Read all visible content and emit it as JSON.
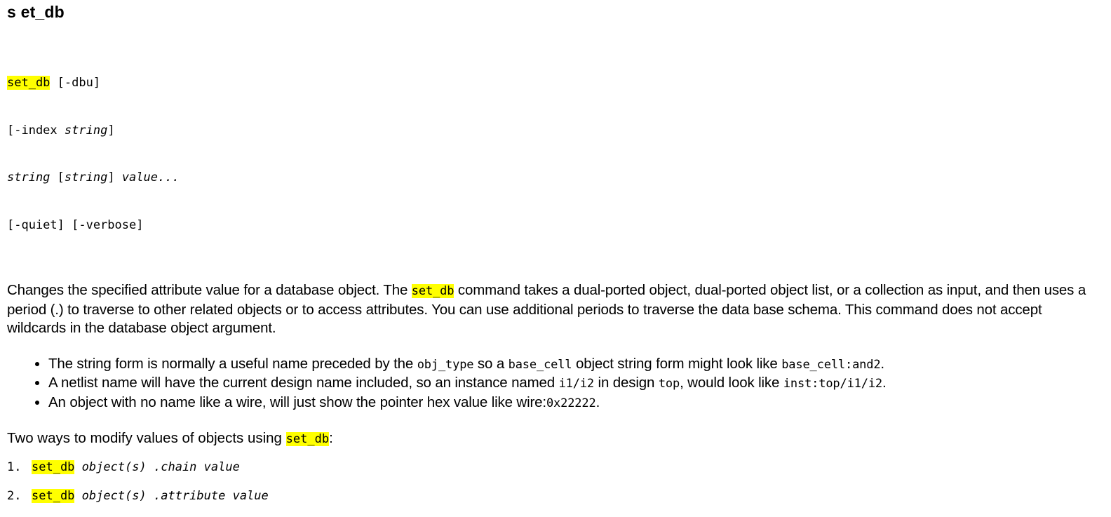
{
  "page": {
    "title": "s et_db"
  },
  "synopsis": {
    "cmd": "set_db",
    "line1_rest": " [-dbu]",
    "line2_open": "[-index ",
    "line2_arg": "string",
    "line2_close": "]",
    "line3_arg1": "string",
    "line3_mid": " [",
    "line3_arg2": "string",
    "line3_close": "] ",
    "line3_arg3": "value...",
    "line4": "[-quiet] [-verbose]"
  },
  "description": {
    "before": "Changes the specified attribute value for a database object. The ",
    "cmd": "set_db",
    "after": " command takes a dual-ported object, dual-ported object list, or a collection as input, and then uses a period (.) to traverse to other related objects or to access attributes. You can use additional periods to traverse the data base schema. This command does not accept wildcards in the database object argument."
  },
  "bullets": [
    {
      "t1": "The string form is normally a useful name preceded by the ",
      "c1": "obj_type",
      "t2": " so a ",
      "c2": "base_cell",
      "t3": " object string form might look like ",
      "c3": "base_cell:and2",
      "t4": "."
    },
    {
      "t1": "A netlist name will have the current design name included, so an instance named ",
      "c1": "i1/i2",
      "t2": " in design ",
      "c2": "top",
      "t3": ", would look like ",
      "c3": "inst:top/i1/i2",
      "t4": "."
    },
    {
      "t1": "An object with no name like a wire, will just show the pointer hex value like wire:",
      "c1": "0x22222",
      "t2": "."
    }
  ],
  "two_ways": {
    "text": "Two ways to modify values of objects using ",
    "cmd": "set_db",
    "suffix": ":"
  },
  "commands": [
    {
      "num": "1.",
      "cmd": "set_db",
      "args": " object(s) .chain value"
    },
    {
      "num": "2.",
      "cmd": "set_db",
      "args": " object(s) .attribute value"
    }
  ],
  "colors": {
    "highlight": "#ffff00",
    "text": "#000000",
    "background": "#ffffff"
  }
}
